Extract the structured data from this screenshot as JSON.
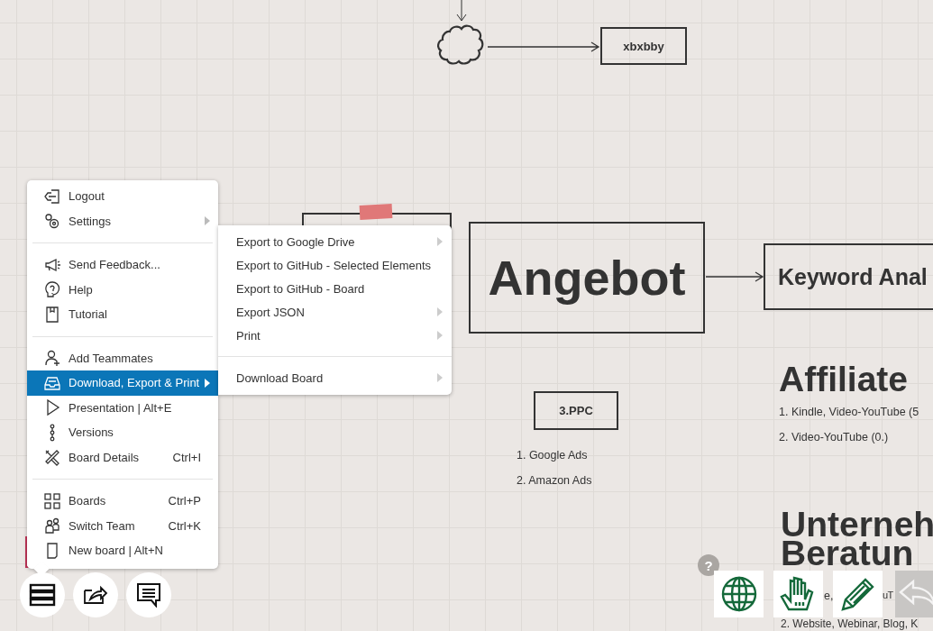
{
  "canvas": {
    "nodes": [
      {
        "kind": "cloud"
      },
      {
        "kind": "box",
        "text": "xbxbby"
      },
      {
        "kind": "taped-box"
      },
      {
        "kind": "box",
        "text": "Angebot"
      },
      {
        "kind": "box",
        "text": "Keyword Anal"
      },
      {
        "kind": "box",
        "text": "3.PPC"
      },
      {
        "kind": "list",
        "lines": [
          "1. Google Ads",
          "2. Amazon Ads"
        ]
      },
      {
        "kind": "heading",
        "lines": [
          "Affiliate"
        ]
      },
      {
        "kind": "list",
        "lines": [
          "1. Kindle, Video-YouTube (5",
          "2. Video-YouTube (0.)"
        ]
      },
      {
        "kind": "heading",
        "lines": [
          "Unterneh",
          "Beratun"
        ]
      },
      {
        "kind": "fragment",
        "lines": [
          "e,"
        ]
      },
      {
        "kind": "fragment",
        "lines": [
          "uT"
        ]
      },
      {
        "kind": "list",
        "lines": [
          "2. Website, Webinar, Blog, K"
        ]
      },
      {
        "kind": "note"
      }
    ]
  },
  "main_menu": {
    "sections": [
      [
        {
          "label": "Logout",
          "submenu": false,
          "selected": false
        },
        {
          "label": "Settings",
          "submenu": true,
          "selected": false
        }
      ],
      [
        {
          "label": "Send Feedback...",
          "submenu": false,
          "selected": false
        },
        {
          "label": "Help",
          "submenu": false,
          "selected": false
        },
        {
          "label": "Tutorial",
          "submenu": false,
          "selected": false
        }
      ],
      [
        {
          "label": "Add Teammates",
          "submenu": false,
          "selected": false
        },
        {
          "label": "Download, Export & Print",
          "submenu": true,
          "selected": true
        },
        {
          "label": "Presentation | Alt+E",
          "submenu": false,
          "selected": false
        },
        {
          "label": "Versions",
          "submenu": false,
          "selected": false
        },
        {
          "label": "Board Details",
          "shortcut": "Ctrl+I",
          "submenu": false,
          "selected": false
        }
      ],
      [
        {
          "label": "Boards",
          "shortcut": "Ctrl+P",
          "submenu": false,
          "selected": false
        },
        {
          "label": "Switch Team",
          "shortcut": "Ctrl+K",
          "submenu": false,
          "selected": false
        },
        {
          "label": "New board | Alt+N",
          "submenu": false,
          "selected": false
        }
      ]
    ]
  },
  "submenu": {
    "sections": [
      [
        {
          "label": "Export to Google Drive",
          "submenu": true
        },
        {
          "label": "Export to GitHub - Selected Elements",
          "submenu": false
        },
        {
          "label": "Export to GitHub - Board",
          "submenu": false
        },
        {
          "label": "Export JSON",
          "submenu": true
        },
        {
          "label": "Print",
          "submenu": true
        }
      ],
      [
        {
          "label": "Download Board",
          "submenu": true
        }
      ]
    ]
  },
  "help_button": {
    "label": "?"
  },
  "tools": [
    {
      "disabled": false
    },
    {
      "disabled": false
    },
    {
      "disabled": false
    },
    {
      "disabled": true
    }
  ]
}
